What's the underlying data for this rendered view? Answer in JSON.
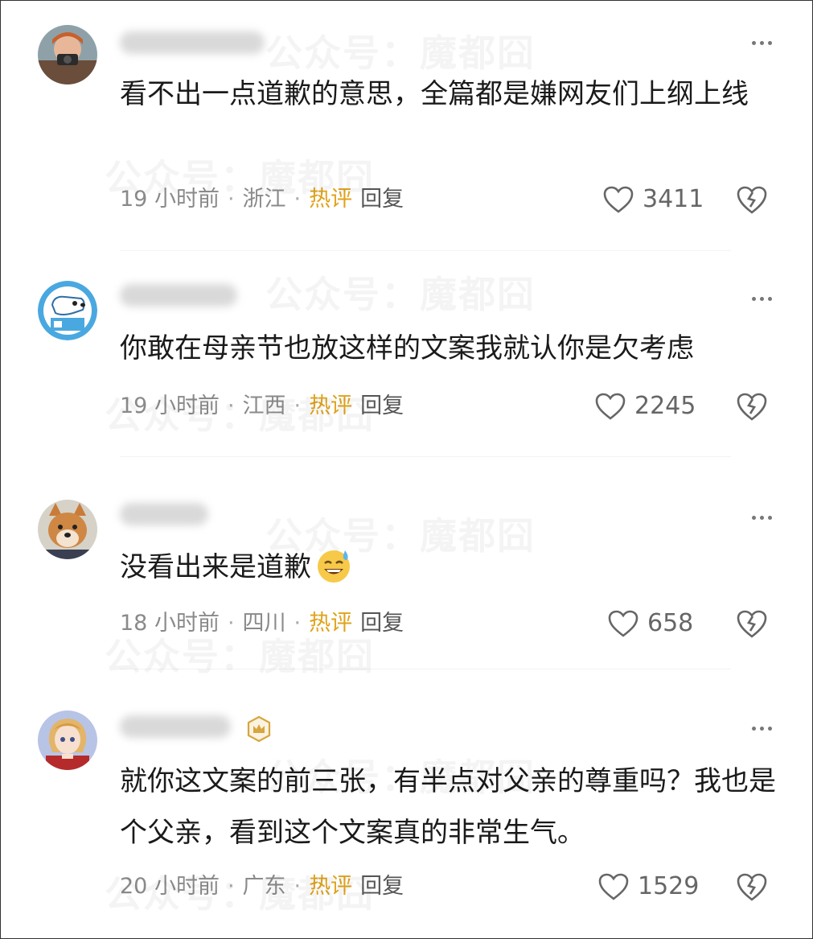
{
  "watermark": {
    "text": "公众号：魔都囧"
  },
  "comments": [
    {
      "text": "看不出一点道歉的意思，全篇都是嫌网友们上纲上线",
      "time": "19 小时前",
      "location": "浙江",
      "hot_label": "热评",
      "reply_label": "回复",
      "likes": "3411",
      "avatar_icon": "child-with-camera-avatar"
    },
    {
      "text": "你敢在母亲节也放这样的文案我就认你是欠考虑",
      "time": "19 小时前",
      "location": "江西",
      "hot_label": "热评",
      "reply_label": "回复",
      "likes": "2245",
      "avatar_icon": "cartoon-dog-avatar"
    },
    {
      "text": "没看出来是道歉",
      "time": "18 小时前",
      "location": "四川",
      "hot_label": "热评",
      "reply_label": "回复",
      "likes": "658",
      "avatar_icon": "shiba-dog-avatar",
      "emoji": "sweat-smile-emoji"
    },
    {
      "text": "就你这文案的前三张，有半点对父亲的尊重吗？我也是个父亲，看到这个文案真的非常生气。",
      "time": "20 小时前",
      "location": "广东",
      "hot_label": "热评",
      "reply_label": "回复",
      "likes": "1529",
      "avatar_icon": "anime-girl-avatar",
      "badge": "crown-badge-icon"
    }
  ],
  "colors": {
    "hot": "#e0a21a",
    "meta": "#8a8a8a",
    "text": "#1a1a1a"
  }
}
